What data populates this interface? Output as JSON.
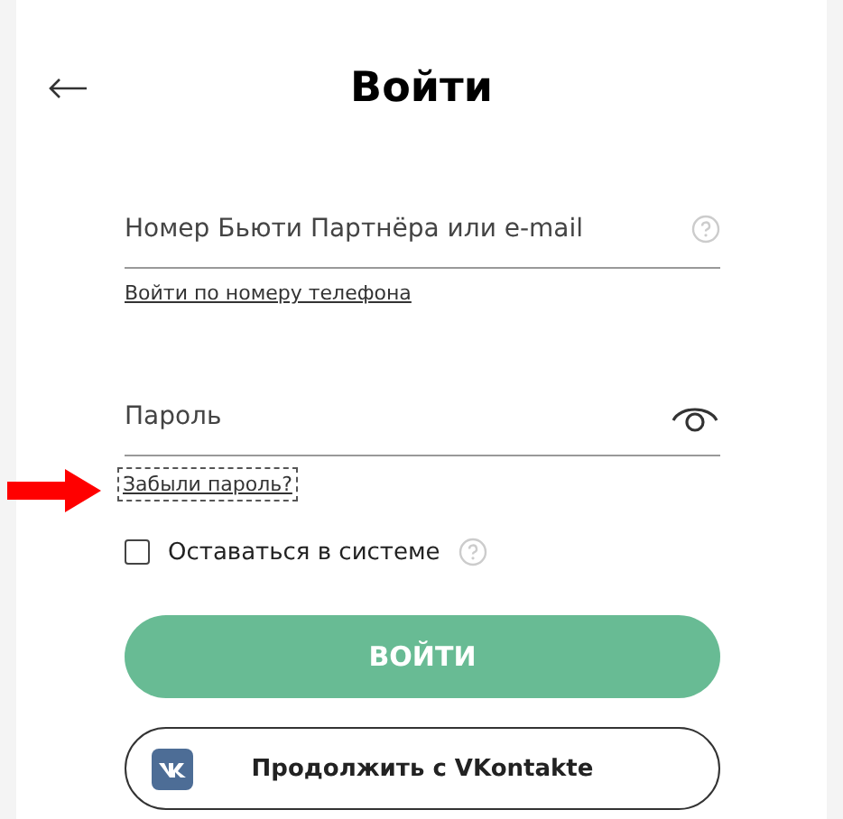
{
  "title": "Войти",
  "login_field": {
    "placeholder": "Номер Бьюти Партнёра или e-mail"
  },
  "phone_link": "Войти по номеру телефона",
  "password_field": {
    "placeholder": "Пароль"
  },
  "forgot_link": "Забыли пароль?",
  "remember": {
    "label": "Оставаться в системе",
    "checked": false
  },
  "login_button": "ВОЙТИ",
  "vk_button": "Продолжить с VKontakte"
}
